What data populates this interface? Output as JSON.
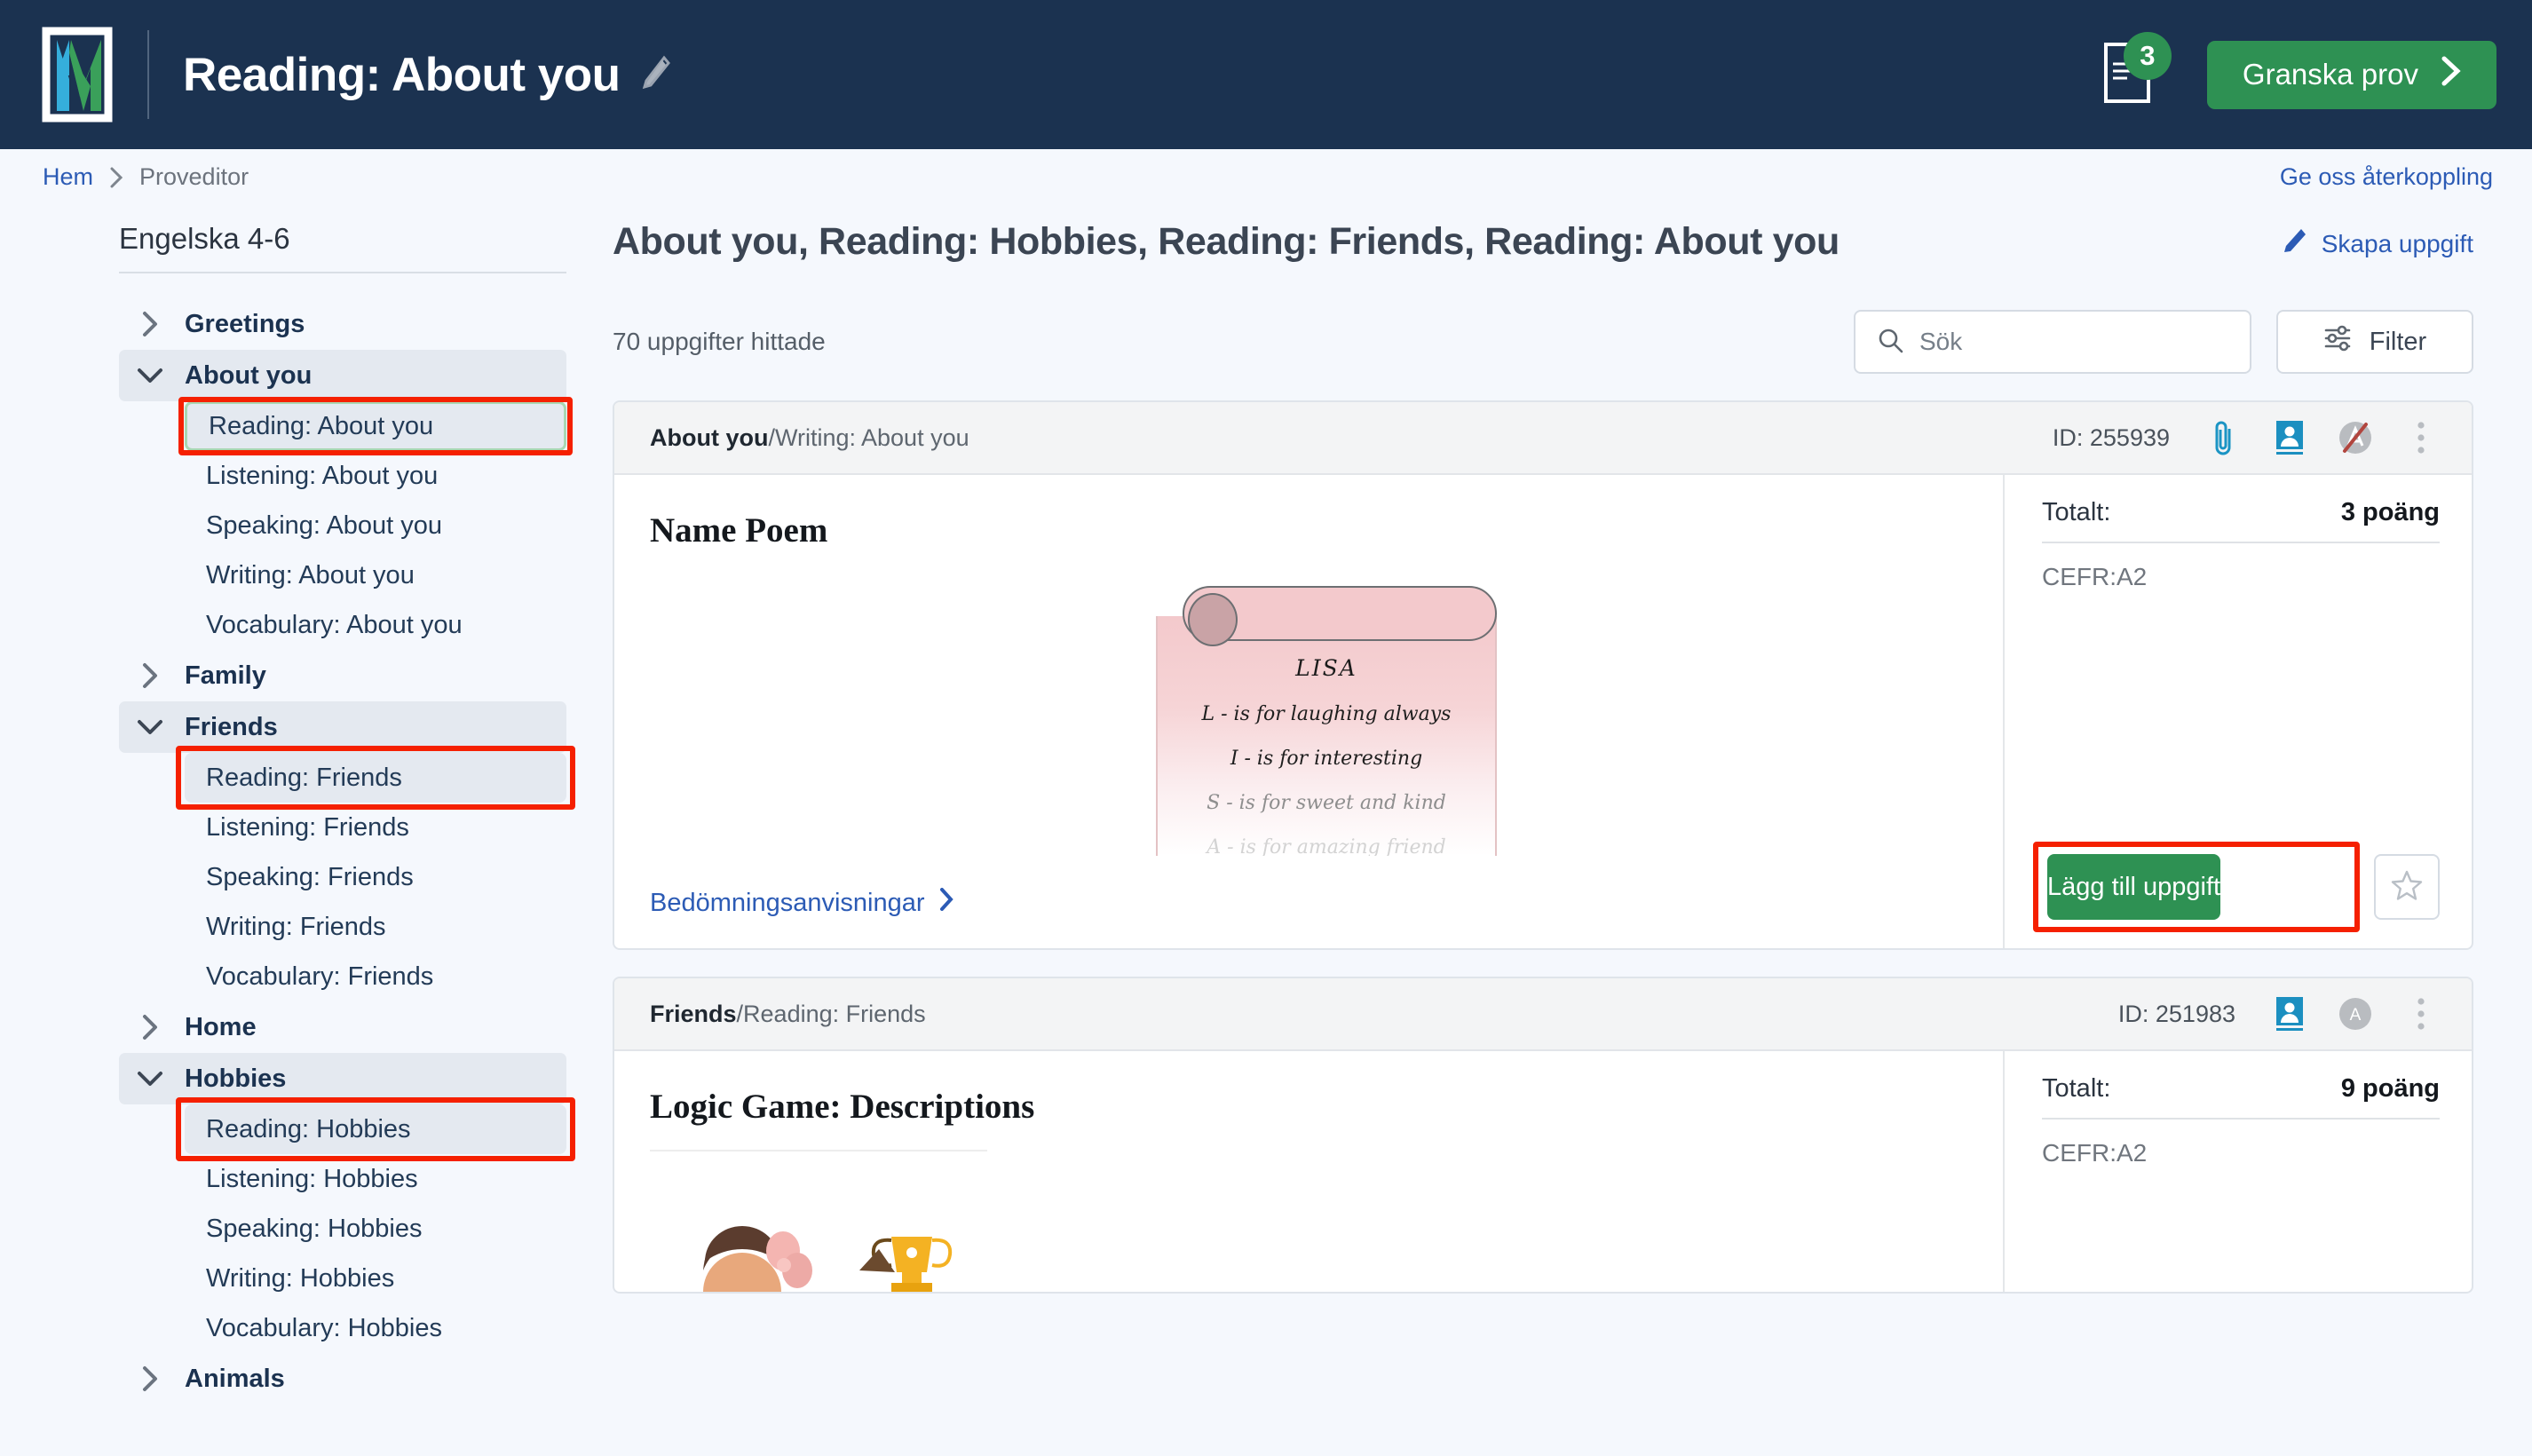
{
  "topbar": {
    "app_title": "Reading: About you",
    "edit_icon": "pencil-icon",
    "doc_icon": "document-icon",
    "badge_count": "3",
    "review_button": "Granska prov",
    "review_chevron": "chevron-right-icon",
    "accent_green": "#2e9153",
    "bar_bg": "#1b3250"
  },
  "breadcrumb": {
    "home": "Hem",
    "separator": "›",
    "current": "Proveditor",
    "feedback": "Ge oss återkoppling",
    "link_color": "#2c5bb5"
  },
  "sidebar": {
    "course_title": "Engelska 4-6",
    "groups": [
      {
        "label": "Greetings",
        "expanded": false,
        "children": []
      },
      {
        "label": "About you",
        "expanded": true,
        "children": [
          {
            "label": "Reading: About you",
            "state": "selected-green",
            "annotated": true
          },
          {
            "label": "Listening: About you",
            "state": "none",
            "annotated": false
          },
          {
            "label": "Speaking: About you",
            "state": "none",
            "annotated": false
          },
          {
            "label": "Writing: About you",
            "state": "none",
            "annotated": false
          },
          {
            "label": "Vocabulary: About you",
            "state": "none",
            "annotated": false
          }
        ]
      },
      {
        "label": "Family",
        "expanded": false,
        "children": []
      },
      {
        "label": "Friends",
        "expanded": true,
        "children": [
          {
            "label": "Reading: Friends",
            "state": "selected-grey",
            "annotated": true
          },
          {
            "label": "Listening: Friends",
            "state": "none",
            "annotated": false
          },
          {
            "label": "Speaking: Friends",
            "state": "none",
            "annotated": false
          },
          {
            "label": "Writing: Friends",
            "state": "none",
            "annotated": false
          },
          {
            "label": "Vocabulary: Friends",
            "state": "none",
            "annotated": false
          }
        ]
      },
      {
        "label": "Home",
        "expanded": false,
        "children": []
      },
      {
        "label": "Hobbies",
        "expanded": true,
        "children": [
          {
            "label": "Reading: Hobbies",
            "state": "selected-grey",
            "annotated": true
          },
          {
            "label": "Listening: Hobbies",
            "state": "none",
            "annotated": false
          },
          {
            "label": "Speaking: Hobbies",
            "state": "none",
            "annotated": false
          },
          {
            "label": "Writing: Hobbies",
            "state": "none",
            "annotated": false
          },
          {
            "label": "Vocabulary: Hobbies",
            "state": "none",
            "annotated": false
          }
        ]
      },
      {
        "label": "Animals",
        "expanded": false,
        "children": []
      }
    ]
  },
  "main": {
    "results_title": "About you, Reading: Hobbies, Reading: Friends, Reading: About you",
    "create_task": "Skapa uppgift",
    "create_task_icon": "pencil-icon",
    "found_count": "70 uppgifter hittade",
    "search_placeholder": "Sök",
    "search_value": "",
    "search_icon": "search-icon",
    "filter_label": "Filter",
    "filter_icon": "sliders-icon"
  },
  "cards": [
    {
      "crumb_bold": "About you",
      "crumb_rest": "/Writing: About you",
      "id_label": "ID: 255939",
      "icons": [
        "paperclip-icon",
        "portrait-icon",
        "no-audio-icon",
        "kebab-menu-icon"
      ],
      "task_title": "Name Poem",
      "assessment_link": "Bedömningsanvisningar",
      "assessment_chevron": "chevron-right-icon",
      "totals_label": "Totalt:",
      "totals_value": "3 poäng",
      "cefr": "CEFR:A2",
      "add_button": "Lägg till uppgift",
      "add_button_annotated": true,
      "star_icon": "star-outline-icon",
      "poem": {
        "name": "LISA",
        "lines": [
          "L - is for laughing always",
          "I - is for interesting",
          "S - is for sweet and kind",
          "A - is for amazing friend"
        ]
      }
    },
    {
      "crumb_bold": "Friends",
      "crumb_rest": "/Reading: Friends",
      "id_label": "ID: 251983",
      "icons": [
        "portrait-icon",
        "auto-scored-icon",
        "kebab-menu-icon"
      ],
      "auto_badge_letter": "A",
      "task_title": "Logic Game: Descriptions",
      "totals_label": "Totalt:",
      "totals_value": "9 poäng",
      "cefr": "CEFR:A2"
    }
  ]
}
